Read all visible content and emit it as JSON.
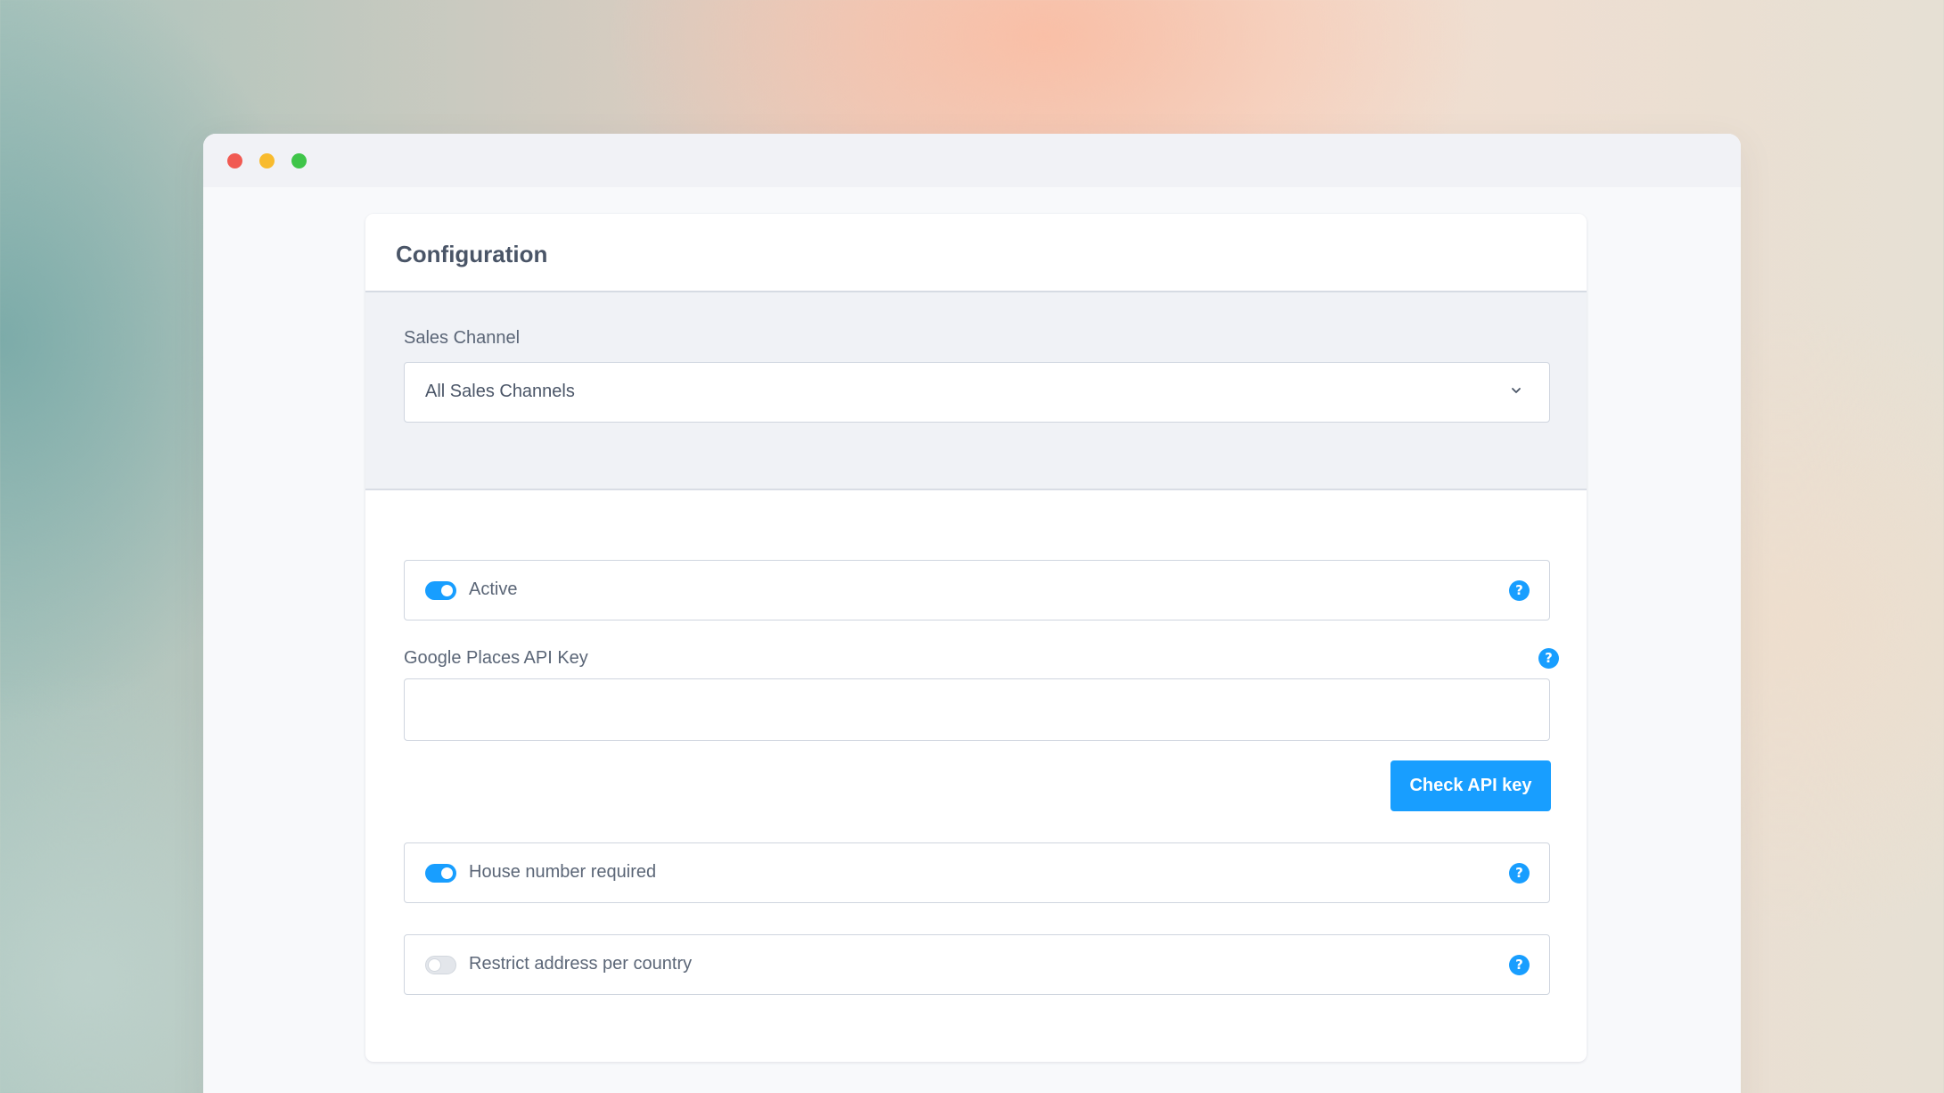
{
  "window": {
    "controls": [
      "close",
      "minimize",
      "maximize"
    ]
  },
  "card": {
    "title": "Configuration"
  },
  "sales_channel": {
    "label": "Sales Channel",
    "selected": "All Sales Channels"
  },
  "settings": {
    "active": {
      "label": "Active",
      "enabled": true
    },
    "api_key": {
      "label": "Google Places API Key",
      "value": "",
      "placeholder": ""
    },
    "check_button": {
      "label": "Check API key"
    },
    "house_number": {
      "label": "House number required",
      "enabled": true
    },
    "restrict_country": {
      "label": "Restrict address per country",
      "enabled": false
    }
  },
  "icons": {
    "help": "?",
    "chevron": "chevron-down-icon"
  },
  "colors": {
    "accent": "#189eff",
    "close": "#f15a52",
    "minimize": "#f8bb2e",
    "maximize": "#3fc549"
  }
}
